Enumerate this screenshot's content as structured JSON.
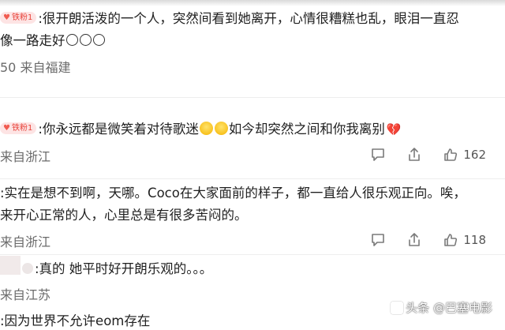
{
  "comments": [
    {
      "badge": "铁粉1",
      "text_line1": ":很开朗活泼的一个人，突然间看到她离开，心情很糟糕也乱，眼泪一直忍",
      "text_line2": "像一路走好",
      "location": "50 来自福建"
    },
    {
      "badge": "铁粉1",
      "text_part1": ":你永远都是微笑着对待歌迷",
      "text_part2": "如今却突然之间和你我离别",
      "location": "来自浙江",
      "likes": "162"
    },
    {
      "text_line1": ":实在是想不到啊，天哪。Coco在大家面前的样子，都一直给人很乐观正向。唉，",
      "text_line2": "来开心正常的人，心里总是有很多苦闷的。",
      "location": "来自浙江",
      "likes": "118"
    },
    {
      "text_line1": ":真的 她平时好开朗乐观的。。。",
      "location": "来自江苏"
    },
    {
      "text_line1": ":因为世界不允许eom存在"
    }
  ],
  "watermark": "头条 @巴塞电影",
  "icons": {
    "comment": "comment-icon",
    "share": "share-icon",
    "like": "thumbs-up-icon",
    "fan_heart": "heart-icon",
    "crying": "crying-emoji-icon",
    "broken_heart": "broken-heart-icon"
  }
}
